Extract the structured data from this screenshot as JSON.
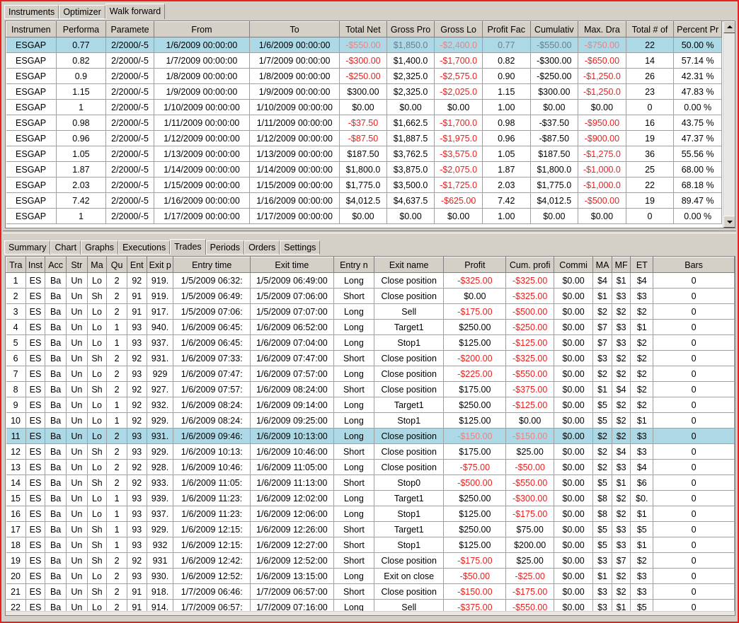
{
  "top_tabs": [
    "Instruments",
    "Optimizer",
    "Walk forward"
  ],
  "top_active_tab": 2,
  "walk_forward": {
    "columns": [
      "Instrumen",
      "Performa",
      "Paramete",
      "From",
      "To",
      "Total Net",
      "Gross Pro",
      "Gross Lo",
      "Profit Fac",
      "Cumulativ",
      "Max. Dra",
      "Total # of",
      "Percent Pr"
    ],
    "selected_row": 0,
    "rows": [
      [
        "ESGAP",
        "0.77",
        "2/2000/-5",
        "1/6/2009 00:00:00",
        "1/6/2009 00:00:00",
        "-$550.00",
        "$1,850.0",
        "-$2,400.0",
        "0.77",
        "-$550.00",
        "-$750.00",
        "22",
        "50.00 %"
      ],
      [
        "ESGAP",
        "0.82",
        "2/2000/-5",
        "1/7/2009 00:00:00",
        "1/7/2009 00:00:00",
        "-$300.00",
        "$1,400.0",
        "-$1,700.0",
        "0.82",
        "-$300.00",
        "-$650.00",
        "14",
        "57.14 %"
      ],
      [
        "ESGAP",
        "0.9",
        "2/2000/-5",
        "1/8/2009 00:00:00",
        "1/8/2009 00:00:00",
        "-$250.00",
        "$2,325.0",
        "-$2,575.0",
        "0.90",
        "-$250.00",
        "-$1,250.0",
        "26",
        "42.31 %"
      ],
      [
        "ESGAP",
        "1.15",
        "2/2000/-5",
        "1/9/2009 00:00:00",
        "1/9/2009 00:00:00",
        "$300.00",
        "$2,325.0",
        "-$2,025.0",
        "1.15",
        "$300.00",
        "-$1,250.0",
        "23",
        "47.83 %"
      ],
      [
        "ESGAP",
        "1",
        "2/2000/-5",
        "1/10/2009 00:00:00",
        "1/10/2009 00:00:00",
        "$0.00",
        "$0.00",
        "$0.00",
        "1.00",
        "$0.00",
        "$0.00",
        "0",
        "0.00 %"
      ],
      [
        "ESGAP",
        "0.98",
        "2/2000/-5",
        "1/11/2009 00:00:00",
        "1/11/2009 00:00:00",
        "-$37.50",
        "$1,662.5",
        "-$1,700.0",
        "0.98",
        "-$37.50",
        "-$950.00",
        "16",
        "43.75 %"
      ],
      [
        "ESGAP",
        "0.96",
        "2/2000/-5",
        "1/12/2009 00:00:00",
        "1/12/2009 00:00:00",
        "-$87.50",
        "$1,887.5",
        "-$1,975.0",
        "0.96",
        "-$87.50",
        "-$900.00",
        "19",
        "47.37 %"
      ],
      [
        "ESGAP",
        "1.05",
        "2/2000/-5",
        "1/13/2009 00:00:00",
        "1/13/2009 00:00:00",
        "$187.50",
        "$3,762.5",
        "-$3,575.0",
        "1.05",
        "$187.50",
        "-$1,275.0",
        "36",
        "55.56 %"
      ],
      [
        "ESGAP",
        "1.87",
        "2/2000/-5",
        "1/14/2009 00:00:00",
        "1/14/2009 00:00:00",
        "$1,800.0",
        "$3,875.0",
        "-$2,075.0",
        "1.87",
        "$1,800.0",
        "-$1,000.0",
        "25",
        "68.00 %"
      ],
      [
        "ESGAP",
        "2.03",
        "2/2000/-5",
        "1/15/2009 00:00:00",
        "1/15/2009 00:00:00",
        "$1,775.0",
        "$3,500.0",
        "-$1,725.0",
        "2.03",
        "$1,775.0",
        "-$1,000.0",
        "22",
        "68.18 %"
      ],
      [
        "ESGAP",
        "7.42",
        "2/2000/-5",
        "1/16/2009 00:00:00",
        "1/16/2009 00:00:00",
        "$4,012.5",
        "$4,637.5",
        "-$625.00",
        "7.42",
        "$4,012.5",
        "-$500.00",
        "19",
        "89.47 %"
      ],
      [
        "ESGAP",
        "1",
        "2/2000/-5",
        "1/17/2009 00:00:00",
        "1/17/2009 00:00:00",
        "$0.00",
        "$0.00",
        "$0.00",
        "1.00",
        "$0.00",
        "$0.00",
        "0",
        "0.00 %"
      ]
    ]
  },
  "bottom_tabs": [
    "Summary",
    "Chart",
    "Graphs",
    "Executions",
    "Trades",
    "Periods",
    "Orders",
    "Settings"
  ],
  "bottom_active_tab": 4,
  "trades": {
    "columns": [
      "Tra",
      "Inst",
      "Acc",
      "Str",
      "Ma",
      "Qu",
      "Ent",
      "Exit p",
      "Entry time",
      "Exit time",
      "Entry n",
      "Exit name",
      "Profit",
      "Cum. profi",
      "Commi",
      "MA",
      "MF",
      "ET",
      "Bars"
    ],
    "selected_row": 10,
    "rows": [
      [
        "1",
        "ES",
        "Ba",
        "Un",
        "Lo",
        "2",
        "92",
        "919.",
        "1/5/2009 06:32:",
        "1/5/2009 06:49:00",
        "Long",
        "Close position",
        "-$325.00",
        "-$325.00",
        "$0.00",
        "$4",
        "$1",
        "$4",
        "0"
      ],
      [
        "2",
        "ES",
        "Ba",
        "Un",
        "Sh",
        "2",
        "91",
        "919.",
        "1/5/2009 06:49:",
        "1/5/2009 07:06:00",
        "Short",
        "Close position",
        "$0.00",
        "-$325.00",
        "$0.00",
        "$1",
        "$3",
        "$3",
        "0"
      ],
      [
        "3",
        "ES",
        "Ba",
        "Un",
        "Lo",
        "2",
        "91",
        "917.",
        "1/5/2009 07:06:",
        "1/5/2009 07:07:00",
        "Long",
        "Sell",
        "-$175.00",
        "-$500.00",
        "$0.00",
        "$2",
        "$2",
        "$2",
        "0"
      ],
      [
        "4",
        "ES",
        "Ba",
        "Un",
        "Lo",
        "1",
        "93",
        "940.",
        "1/6/2009 06:45:",
        "1/6/2009 06:52:00",
        "Long",
        "Target1",
        "$250.00",
        "-$250.00",
        "$0.00",
        "$7",
        "$3",
        "$1",
        "0"
      ],
      [
        "5",
        "ES",
        "Ba",
        "Un",
        "Lo",
        "1",
        "93",
        "937.",
        "1/6/2009 06:45:",
        "1/6/2009 07:04:00",
        "Long",
        "Stop1",
        "$125.00",
        "-$125.00",
        "$0.00",
        "$7",
        "$3",
        "$2",
        "0"
      ],
      [
        "6",
        "ES",
        "Ba",
        "Un",
        "Sh",
        "2",
        "92",
        "931.",
        "1/6/2009 07:33:",
        "1/6/2009 07:47:00",
        "Short",
        "Close position",
        "-$200.00",
        "-$325.00",
        "$0.00",
        "$3",
        "$2",
        "$2",
        "0"
      ],
      [
        "7",
        "ES",
        "Ba",
        "Un",
        "Lo",
        "2",
        "93",
        "929",
        "1/6/2009 07:47:",
        "1/6/2009 07:57:00",
        "Long",
        "Close position",
        "-$225.00",
        "-$550.00",
        "$0.00",
        "$2",
        "$2",
        "$2",
        "0"
      ],
      [
        "8",
        "ES",
        "Ba",
        "Un",
        "Sh",
        "2",
        "92",
        "927.",
        "1/6/2009 07:57:",
        "1/6/2009 08:24:00",
        "Short",
        "Close position",
        "$175.00",
        "-$375.00",
        "$0.00",
        "$1",
        "$4",
        "$2",
        "0"
      ],
      [
        "9",
        "ES",
        "Ba",
        "Un",
        "Lo",
        "1",
        "92",
        "932.",
        "1/6/2009 08:24:",
        "1/6/2009 09:14:00",
        "Long",
        "Target1",
        "$250.00",
        "-$125.00",
        "$0.00",
        "$5",
        "$2",
        "$2",
        "0"
      ],
      [
        "10",
        "ES",
        "Ba",
        "Un",
        "Lo",
        "1",
        "92",
        "929.",
        "1/6/2009 08:24:",
        "1/6/2009 09:25:00",
        "Long",
        "Stop1",
        "$125.00",
        "$0.00",
        "$0.00",
        "$5",
        "$2",
        "$1",
        "0"
      ],
      [
        "11",
        "ES",
        "Ba",
        "Un",
        "Lo",
        "2",
        "93",
        "931.",
        "1/6/2009 09:46:",
        "1/6/2009 10:13:00",
        "Long",
        "Close position",
        "-$150.00",
        "-$150.00",
        "$0.00",
        "$2",
        "$2",
        "$3",
        "0"
      ],
      [
        "12",
        "ES",
        "Ba",
        "Un",
        "Sh",
        "2",
        "93",
        "929.",
        "1/6/2009 10:13:",
        "1/6/2009 10:46:00",
        "Short",
        "Close position",
        "$175.00",
        "$25.00",
        "$0.00",
        "$2",
        "$4",
        "$3",
        "0"
      ],
      [
        "13",
        "ES",
        "Ba",
        "Un",
        "Lo",
        "2",
        "92",
        "928.",
        "1/6/2009 10:46:",
        "1/6/2009 11:05:00",
        "Long",
        "Close position",
        "-$75.00",
        "-$50.00",
        "$0.00",
        "$2",
        "$3",
        "$4",
        "0"
      ],
      [
        "14",
        "ES",
        "Ba",
        "Un",
        "Sh",
        "2",
        "92",
        "933.",
        "1/6/2009 11:05:",
        "1/6/2009 11:13:00",
        "Short",
        "Stop0",
        "-$500.00",
        "-$550.00",
        "$0.00",
        "$5",
        "$1",
        "$6",
        "0"
      ],
      [
        "15",
        "ES",
        "Ba",
        "Un",
        "Lo",
        "1",
        "93",
        "939.",
        "1/6/2009 11:23:",
        "1/6/2009 12:02:00",
        "Long",
        "Target1",
        "$250.00",
        "-$300.00",
        "$0.00",
        "$8",
        "$2",
        "$0.",
        "0"
      ],
      [
        "16",
        "ES",
        "Ba",
        "Un",
        "Lo",
        "1",
        "93",
        "937.",
        "1/6/2009 11:23:",
        "1/6/2009 12:06:00",
        "Long",
        "Stop1",
        "$125.00",
        "-$175.00",
        "$0.00",
        "$8",
        "$2",
        "$1",
        "0"
      ],
      [
        "17",
        "ES",
        "Ba",
        "Un",
        "Sh",
        "1",
        "93",
        "929.",
        "1/6/2009 12:15:",
        "1/6/2009 12:26:00",
        "Short",
        "Target1",
        "$250.00",
        "$75.00",
        "$0.00",
        "$5",
        "$3",
        "$5",
        "0"
      ],
      [
        "18",
        "ES",
        "Ba",
        "Un",
        "Sh",
        "1",
        "93",
        "932",
        "1/6/2009 12:15:",
        "1/6/2009 12:27:00",
        "Short",
        "Stop1",
        "$125.00",
        "$200.00",
        "$0.00",
        "$5",
        "$3",
        "$1",
        "0"
      ],
      [
        "19",
        "ES",
        "Ba",
        "Un",
        "Sh",
        "2",
        "92",
        "931",
        "1/6/2009 12:42:",
        "1/6/2009 12:52:00",
        "Short",
        "Close position",
        "-$175.00",
        "$25.00",
        "$0.00",
        "$3",
        "$7",
        "$2",
        "0"
      ],
      [
        "20",
        "ES",
        "Ba",
        "Un",
        "Lo",
        "2",
        "93",
        "930.",
        "1/6/2009 12:52:",
        "1/6/2009 13:15:00",
        "Long",
        "Exit on close",
        "-$50.00",
        "-$25.00",
        "$0.00",
        "$1",
        "$2",
        "$3",
        "0"
      ],
      [
        "21",
        "ES",
        "Ba",
        "Un",
        "Sh",
        "2",
        "91",
        "918.",
        "1/7/2009 06:46:",
        "1/7/2009 06:57:00",
        "Short",
        "Close position",
        "-$150.00",
        "-$175.00",
        "$0.00",
        "$3",
        "$2",
        "$3",
        "0"
      ],
      [
        "22",
        "ES",
        "Ba",
        "Un",
        "Lo",
        "2",
        "91",
        "914.",
        "1/7/2009 06:57:",
        "1/7/2009 07:16:00",
        "Long",
        "Sell",
        "-$375.00",
        "-$550.00",
        "$0.00",
        "$3",
        "$1",
        "$5",
        "0"
      ]
    ]
  },
  "colors": {
    "negative": "#e8201e",
    "selection": "#add8e6",
    "frame": "#e8201e",
    "chrome": "#d4d0c8"
  },
  "icons": {
    "scroll_up": "scroll-up-icon",
    "scroll_down": "scroll-down-icon"
  }
}
